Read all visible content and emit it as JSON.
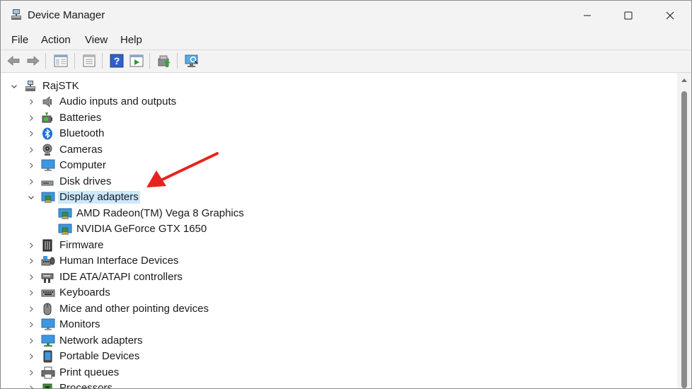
{
  "window": {
    "title": "Device Manager",
    "icon": "device-manager-icon",
    "controls": [
      "minimize-icon",
      "maximize-icon",
      "close-icon"
    ]
  },
  "menu": {
    "file": "File",
    "action": "Action",
    "view": "View",
    "help": "Help"
  },
  "toolbar": {
    "buttons": [
      "back-arrow-icon",
      "forward-arrow-icon",
      "properties-pane-icon",
      "list-view-icon",
      "help-icon",
      "run-icon",
      "update-driver-icon",
      "scan-hardware-icon"
    ]
  },
  "tree": {
    "root": {
      "label": "RajSTK",
      "icon": "computer-root-icon",
      "expanded": true
    },
    "categories": [
      {
        "label": "Audio inputs and outputs",
        "icon": "speaker-icon"
      },
      {
        "label": "Batteries",
        "icon": "battery-icon"
      },
      {
        "label": "Bluetooth",
        "icon": "bluetooth-icon"
      },
      {
        "label": "Cameras",
        "icon": "camera-icon"
      },
      {
        "label": "Computer",
        "icon": "monitor-icon"
      },
      {
        "label": "Disk drives",
        "icon": "disk-drive-icon"
      },
      {
        "label": "Display adapters",
        "icon": "display-adapter-icon",
        "expanded": true,
        "selected": true,
        "children": [
          {
            "label": "AMD Radeon(TM) Vega 8 Graphics",
            "icon": "display-adapter-icon"
          },
          {
            "label": "NVIDIA GeForce GTX 1650",
            "icon": "display-adapter-icon"
          }
        ]
      },
      {
        "label": "Firmware",
        "icon": "firmware-icon"
      },
      {
        "label": "Human Interface Devices",
        "icon": "hid-icon"
      },
      {
        "label": "IDE ATA/ATAPI controllers",
        "icon": "ide-controller-icon"
      },
      {
        "label": "Keyboards",
        "icon": "keyboard-icon"
      },
      {
        "label": "Mice and other pointing devices",
        "icon": "mouse-icon"
      },
      {
        "label": "Monitors",
        "icon": "monitor-icon"
      },
      {
        "label": "Network adapters",
        "icon": "network-adapter-icon"
      },
      {
        "label": "Portable Devices",
        "icon": "portable-device-icon"
      },
      {
        "label": "Print queues",
        "icon": "printer-icon"
      },
      {
        "label": "Processors",
        "icon": "processor-icon"
      }
    ]
  },
  "colors": {
    "selection": "#cce8ff",
    "annotation_arrow": "#e8231d",
    "chrome": "#f3f3f3"
  }
}
